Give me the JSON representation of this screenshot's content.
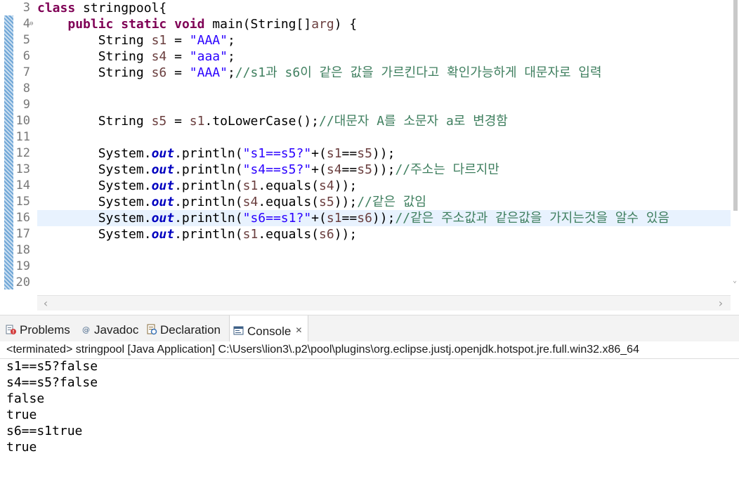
{
  "editor": {
    "lines": [
      {
        "num": "3",
        "fold": "",
        "segments": [
          [
            "kw",
            "class"
          ],
          [
            "plain",
            " stringpool{"
          ]
        ]
      },
      {
        "num": "4",
        "fold": "⊖",
        "segments": [
          [
            "plain",
            "    "
          ],
          [
            "kw",
            "public"
          ],
          [
            "plain",
            " "
          ],
          [
            "kw",
            "static"
          ],
          [
            "plain",
            " "
          ],
          [
            "kw",
            "void"
          ],
          [
            "plain",
            " main(String[]"
          ],
          [
            "var",
            "arg"
          ],
          [
            "plain",
            ") {"
          ]
        ]
      },
      {
        "num": "5",
        "fold": "",
        "segments": [
          [
            "plain",
            "        String "
          ],
          [
            "var",
            "s1"
          ],
          [
            "plain",
            " = "
          ],
          [
            "str",
            "\"AAA\""
          ],
          [
            "plain",
            ";"
          ]
        ]
      },
      {
        "num": "6",
        "fold": "",
        "segments": [
          [
            "plain",
            "        String "
          ],
          [
            "var",
            "s4"
          ],
          [
            "plain",
            " = "
          ],
          [
            "str",
            "\"aaa\""
          ],
          [
            "plain",
            ";"
          ]
        ]
      },
      {
        "num": "7",
        "fold": "",
        "segments": [
          [
            "plain",
            "        String "
          ],
          [
            "var",
            "s6"
          ],
          [
            "plain",
            " = "
          ],
          [
            "str",
            "\"AAA\""
          ],
          [
            "plain",
            ";"
          ],
          [
            "cmt",
            "//s1과 s6이 같은 값을 가르킨다고 확인가능하게 대문자로 입력"
          ]
        ]
      },
      {
        "num": "8",
        "fold": "",
        "segments": []
      },
      {
        "num": "9",
        "fold": "",
        "segments": []
      },
      {
        "num": "10",
        "fold": "",
        "segments": [
          [
            "plain",
            "        String "
          ],
          [
            "var",
            "s5"
          ],
          [
            "plain",
            " = "
          ],
          [
            "var",
            "s1"
          ],
          [
            "plain",
            ".toLowerCase();"
          ],
          [
            "cmt",
            "//대문자 A를 소문자 a로 변경함"
          ]
        ]
      },
      {
        "num": "11",
        "fold": "",
        "segments": []
      },
      {
        "num": "12",
        "fold": "",
        "segments": [
          [
            "plain",
            "        System."
          ],
          [
            "fld",
            "out"
          ],
          [
            "plain",
            ".println("
          ],
          [
            "str",
            "\"s1==s5?\""
          ],
          [
            "plain",
            "+("
          ],
          [
            "var",
            "s1"
          ],
          [
            "plain",
            "=="
          ],
          [
            "var",
            "s5"
          ],
          [
            "plain",
            "));"
          ]
        ]
      },
      {
        "num": "13",
        "fold": "",
        "segments": [
          [
            "plain",
            "        System."
          ],
          [
            "fld",
            "out"
          ],
          [
            "plain",
            ".println("
          ],
          [
            "str",
            "\"s4==s5?\""
          ],
          [
            "plain",
            "+("
          ],
          [
            "var",
            "s4"
          ],
          [
            "plain",
            "=="
          ],
          [
            "var",
            "s5"
          ],
          [
            "plain",
            "));"
          ],
          [
            "cmt",
            "//주소는 다르지만"
          ]
        ]
      },
      {
        "num": "14",
        "fold": "",
        "segments": [
          [
            "plain",
            "        System."
          ],
          [
            "fld",
            "out"
          ],
          [
            "plain",
            ".println("
          ],
          [
            "var",
            "s1"
          ],
          [
            "plain",
            ".equals("
          ],
          [
            "var",
            "s4"
          ],
          [
            "plain",
            "));"
          ]
        ]
      },
      {
        "num": "15",
        "fold": "",
        "segments": [
          [
            "plain",
            "        System."
          ],
          [
            "fld",
            "out"
          ],
          [
            "plain",
            ".println("
          ],
          [
            "var",
            "s4"
          ],
          [
            "plain",
            ".equals("
          ],
          [
            "var",
            "s5"
          ],
          [
            "plain",
            "));"
          ],
          [
            "cmt",
            "//같은 값임"
          ]
        ]
      },
      {
        "num": "16",
        "fold": "",
        "segments": [
          [
            "plain",
            "        System."
          ],
          [
            "fld",
            "out"
          ],
          [
            "plain",
            ".println("
          ],
          [
            "str",
            "\"s6==s1?\""
          ],
          [
            "plain",
            "+("
          ],
          [
            "var",
            "s1"
          ],
          [
            "plain",
            "=="
          ],
          [
            "var",
            "s6"
          ],
          [
            "plain",
            "));"
          ],
          [
            "cmt",
            "//같은 주소값과 같은값을 가지는것을 알수 있음"
          ]
        ]
      },
      {
        "num": "17",
        "fold": "",
        "segments": [
          [
            "plain",
            "        System."
          ],
          [
            "fld",
            "out"
          ],
          [
            "plain",
            ".println("
          ],
          [
            "var",
            "s1"
          ],
          [
            "plain",
            ".equals("
          ],
          [
            "var",
            "s6"
          ],
          [
            "plain",
            "));"
          ]
        ]
      },
      {
        "num": "18",
        "fold": "",
        "segments": []
      },
      {
        "num": "19",
        "fold": "",
        "segments": []
      },
      {
        "num": "20",
        "fold": "",
        "segments": []
      }
    ]
  },
  "views": {
    "tabs": [
      {
        "label": "Problems",
        "icon": "problems-icon"
      },
      {
        "label": "Javadoc",
        "icon": "javadoc-icon"
      },
      {
        "label": "Declaration",
        "icon": "declaration-icon"
      },
      {
        "label": "Console",
        "icon": "console-icon",
        "active": true,
        "close": "✕"
      }
    ]
  },
  "console": {
    "status": "<terminated> stringpool [Java Application] C:\\Users\\lion3\\.p2\\pool\\plugins\\org.eclipse.justj.openjdk.hotspot.jre.full.win32.x86_64",
    "output": [
      "s1==s5?false",
      "s4==s5?false",
      "false",
      "true",
      "s6==s1true",
      "true"
    ]
  }
}
